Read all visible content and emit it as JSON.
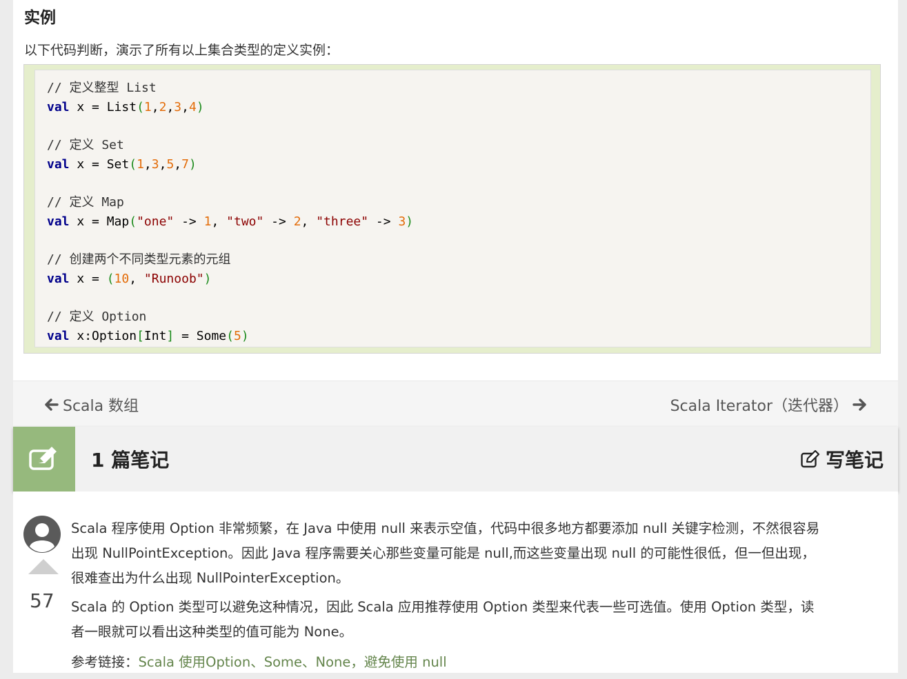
{
  "article": {
    "heading": "实例",
    "intro": "以下代码判断，演示了所有以上集合类型的定义实例：",
    "code_lines": [
      [
        {
          "t": "cm",
          "v": "// 定义整型 List"
        }
      ],
      [
        {
          "t": "kw",
          "v": "val"
        },
        {
          "t": "pl",
          "v": " x = List"
        },
        {
          "t": "pun",
          "v": "("
        },
        {
          "t": "num",
          "v": "1"
        },
        {
          "t": "pl",
          "v": ","
        },
        {
          "t": "num",
          "v": "2"
        },
        {
          "t": "pl",
          "v": ","
        },
        {
          "t": "num",
          "v": "3"
        },
        {
          "t": "pl",
          "v": ","
        },
        {
          "t": "num",
          "v": "4"
        },
        {
          "t": "pun",
          "v": ")"
        }
      ],
      [],
      [
        {
          "t": "cm",
          "v": "// 定义 Set"
        }
      ],
      [
        {
          "t": "kw",
          "v": "val"
        },
        {
          "t": "pl",
          "v": " x = Set"
        },
        {
          "t": "pun",
          "v": "("
        },
        {
          "t": "num",
          "v": "1"
        },
        {
          "t": "pl",
          "v": ","
        },
        {
          "t": "num",
          "v": "3"
        },
        {
          "t": "pl",
          "v": ","
        },
        {
          "t": "num",
          "v": "5"
        },
        {
          "t": "pl",
          "v": ","
        },
        {
          "t": "num",
          "v": "7"
        },
        {
          "t": "pun",
          "v": ")"
        }
      ],
      [],
      [
        {
          "t": "cm",
          "v": "// 定义 Map"
        }
      ],
      [
        {
          "t": "kw",
          "v": "val"
        },
        {
          "t": "pl",
          "v": " x = Map"
        },
        {
          "t": "pun",
          "v": "("
        },
        {
          "t": "str",
          "v": "\"one\""
        },
        {
          "t": "pl",
          "v": " -> "
        },
        {
          "t": "num",
          "v": "1"
        },
        {
          "t": "pl",
          "v": ", "
        },
        {
          "t": "str",
          "v": "\"two\""
        },
        {
          "t": "pl",
          "v": " -> "
        },
        {
          "t": "num",
          "v": "2"
        },
        {
          "t": "pl",
          "v": ", "
        },
        {
          "t": "str",
          "v": "\"three\""
        },
        {
          "t": "pl",
          "v": " -> "
        },
        {
          "t": "num",
          "v": "3"
        },
        {
          "t": "pun",
          "v": ")"
        }
      ],
      [],
      [
        {
          "t": "cm",
          "v": "// 创建两个不同类型元素的元组"
        }
      ],
      [
        {
          "t": "kw",
          "v": "val"
        },
        {
          "t": "pl",
          "v": " x = "
        },
        {
          "t": "pun",
          "v": "("
        },
        {
          "t": "num",
          "v": "10"
        },
        {
          "t": "pl",
          "v": ", "
        },
        {
          "t": "str",
          "v": "\"Runoob\""
        },
        {
          "t": "pun",
          "v": ")"
        }
      ],
      [],
      [
        {
          "t": "cm",
          "v": "// 定义 Option"
        }
      ],
      [
        {
          "t": "kw",
          "v": "val"
        },
        {
          "t": "pl",
          "v": " x:Option"
        },
        {
          "t": "pun",
          "v": "["
        },
        {
          "t": "pl",
          "v": "Int"
        },
        {
          "t": "pun",
          "v": "]"
        },
        {
          "t": "pl",
          "v": " = Some"
        },
        {
          "t": "pun",
          "v": "("
        },
        {
          "t": "num",
          "v": "5"
        },
        {
          "t": "pun",
          "v": ")"
        }
      ]
    ]
  },
  "pager": {
    "prev_label": "Scala 数组",
    "next_label": "Scala Iterator（迭代器）"
  },
  "notes": {
    "count_label": "1 篇笔记",
    "write_label": "写笔记"
  },
  "note": {
    "votes": "57",
    "paragraphs": [
      "Scala 程序使用 Option 非常频繁，在 Java 中使用 null 来表示空值，代码中很多地方都要添加 null 关键字检测，不然很容易出现 NullPointException。因此 Java 程序需要关心那些变量可能是 null,而这些变量出现 null 的可能性很低，但一但出现，很难查出为什么出现 NullPointerException。",
      "Scala 的 Option 类型可以避免这种情况，因此 Scala 应用推荐使用 Option 类型来代表一些可选值。使用 Option 类型，读者一眼就可以看出这种类型的值可能为 None。"
    ],
    "ref_prefix": "参考链接：",
    "ref_link": "Scala 使用Option、Some、None，避免使用 null"
  },
  "colors": {
    "accent_green": "#96b97d",
    "link_green": "#64854c",
    "example_bg": "#e5eecc",
    "keyword": "#00008b",
    "number": "#e36c09",
    "string": "#8b0000"
  },
  "icons": [
    "arrow-left-icon",
    "arrow-right-icon",
    "edit-note-icon",
    "pencil-square-icon",
    "user-avatar-icon",
    "vote-up-icon"
  ]
}
